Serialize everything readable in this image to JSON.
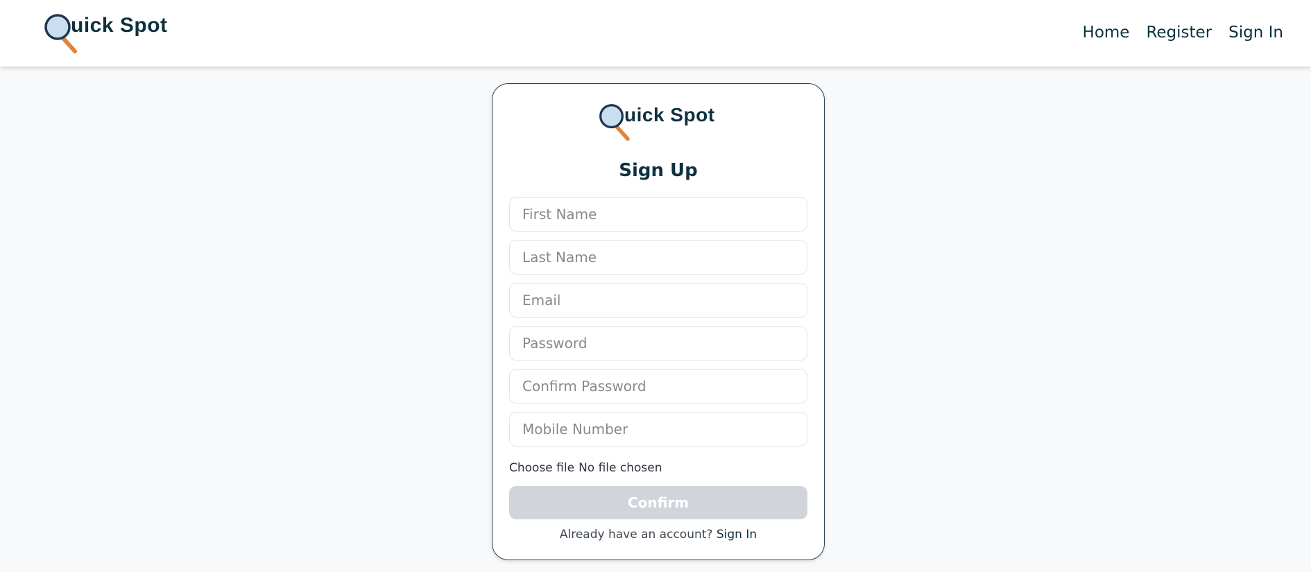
{
  "brand": {
    "name": "uick Spot",
    "logo_letter_icon": "magnifying-glass-icon"
  },
  "nav": {
    "links": [
      "Home",
      "Register",
      "Sign In"
    ]
  },
  "card": {
    "title": "Sign Up",
    "fields": {
      "first_name": "First Name",
      "last_name": "Last Name",
      "email": "Email",
      "password": "Password",
      "confirm_password": "Confirm Password",
      "mobile": "Mobile Number"
    },
    "file": {
      "button": "Choose file",
      "status": "No file chosen"
    },
    "confirm_label": "Confirm",
    "footer": {
      "prompt": "Already have an account?",
      "link": "Sign In"
    }
  },
  "colors": {
    "brand": "#0e3140",
    "page_background": "#f8f9fb",
    "confirm_disabled": "#d1d5db",
    "magnifier_lens": "#c9dff0",
    "magnifier_handle": "#e0843a"
  }
}
